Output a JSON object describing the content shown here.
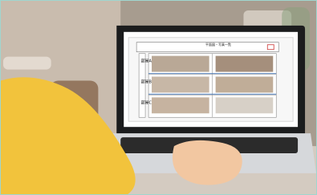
{
  "photo": {
    "alt": "",
    "colors": {
      "wall_left": "#c9bcae",
      "wall_right": "#a79c8f",
      "sofa": "#f0b45f",
      "laptop_body": "#d6d8db",
      "laptop_bezel": "#1b1c1d",
      "screen_bg": "#ffffff",
      "shirt": "#f2c33c",
      "skin": "#f2c7a1"
    }
  },
  "screen": {
    "document_title": "平面図・写真一覧",
    "section_labels": [
      "部屋A",
      "部屋B",
      "部屋C"
    ]
  }
}
